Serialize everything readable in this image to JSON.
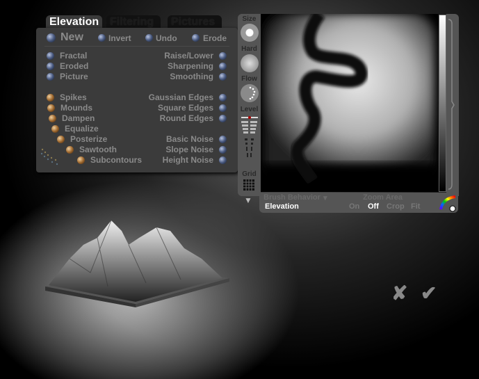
{
  "tabs": [
    {
      "label": "Elevation",
      "active": true
    },
    {
      "label": "Filtering",
      "active": false
    },
    {
      "label": "Pictures",
      "active": false
    }
  ],
  "top_buttons": {
    "new": "New",
    "invert": "Invert",
    "undo": "Undo",
    "erode": "Erode"
  },
  "left_generators": [
    "Fractal",
    "Eroded",
    "Picture"
  ],
  "right_generators": [
    "Raise/Lower",
    "Sharpening",
    "Smoothing"
  ],
  "left_filters": [
    "Spikes",
    "Mounds",
    "Dampen",
    "Equalize",
    "Posterize",
    "Sawtooth",
    "Subcontours"
  ],
  "right_edges": [
    "Gaussian Edges",
    "Square Edges",
    "Round Edges"
  ],
  "right_noise": [
    "Basic Noise",
    "Slope Noise",
    "Height Noise"
  ],
  "brush": {
    "size": "Size",
    "hard": "Hard",
    "flow": "Flow",
    "level": "Level",
    "grid": "Grid"
  },
  "bottom": {
    "brush_behavior": "Brush Behavior",
    "brush_value": "Elevation",
    "zoom_area": "Zoom Area",
    "zoom_options": [
      "On",
      "Off",
      "Crop",
      "Fit"
    ],
    "zoom_selected": "Off"
  },
  "colors": {
    "panel": "#3b3b3b",
    "text": "#8a8a8a",
    "active": "#ffffff"
  }
}
